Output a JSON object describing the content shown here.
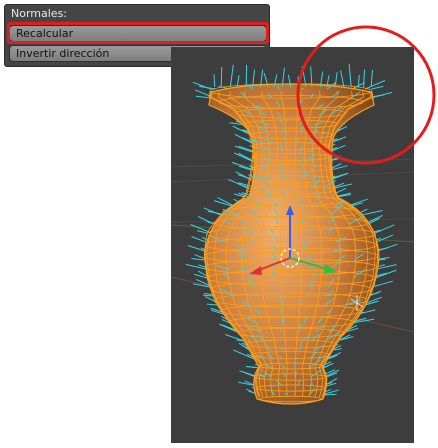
{
  "panel": {
    "title": "Normales:",
    "buttons": [
      {
        "label": "Recalcular",
        "highlighted": true
      },
      {
        "label": "Invertir dirección",
        "highlighted": false
      }
    ]
  },
  "viewport": {
    "background": "#3d3d3d",
    "mesh_color": "#e59a35",
    "wire_color": "#ff9f1a",
    "normals_color": "#33d6e6",
    "highlight_color": "#e31c1c"
  }
}
